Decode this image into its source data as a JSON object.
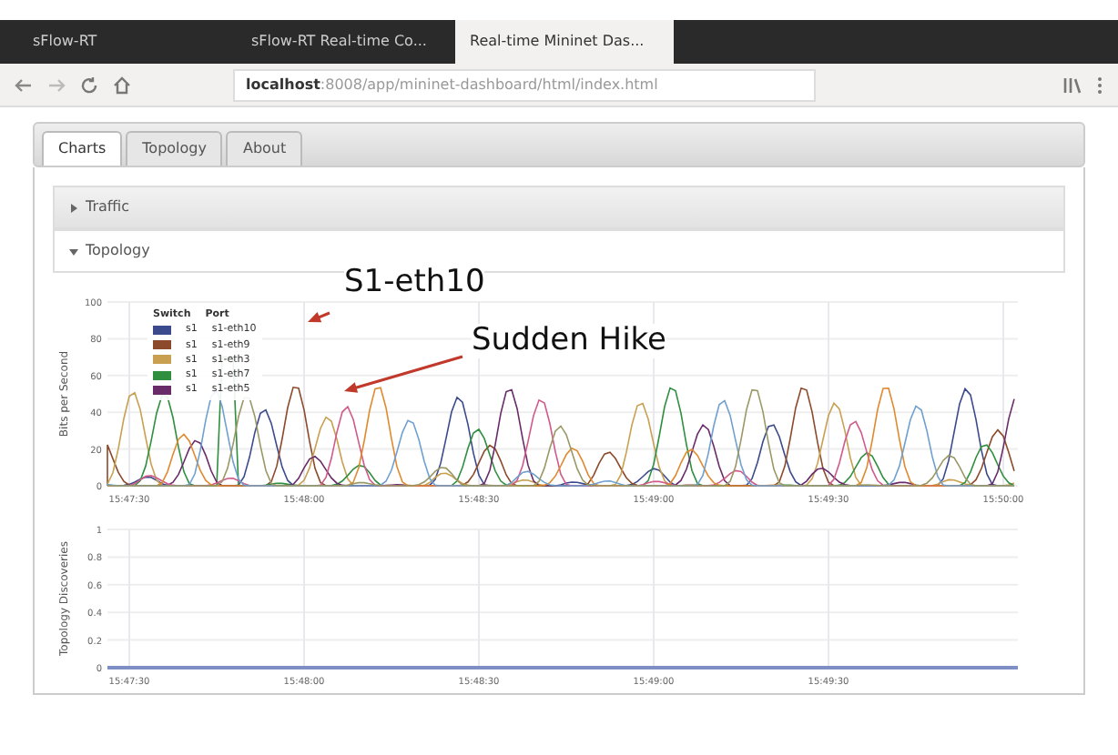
{
  "browser_tabs": [
    {
      "title": "sFlow-RT",
      "selected": false
    },
    {
      "title": "sFlow-RT Real-time Co...",
      "selected": false
    },
    {
      "title": "Real-time Mininet Das...",
      "selected": true
    }
  ],
  "address_bar": {
    "host": "localhost",
    "path": ":8008/app/mininet-dashboard/html/index.html"
  },
  "page_tabs": [
    {
      "label": "Charts",
      "selected": true
    },
    {
      "label": "Topology",
      "selected": false
    },
    {
      "label": "About",
      "selected": false
    }
  ],
  "sections": [
    {
      "label": "Traffic",
      "expanded": false
    },
    {
      "label": "Topology",
      "expanded": true
    }
  ],
  "traffic_chart": {
    "ylabel": "Bits per Second",
    "yticks": [
      "100",
      "80",
      "60",
      "40",
      "20",
      "0"
    ],
    "xticks": [
      "15:47:30",
      "15:48:00",
      "15:48:30",
      "15:49:00",
      "15:49:30",
      "15:50:00"
    ],
    "legend_headers": [
      "Switch",
      "Port"
    ],
    "legend": [
      {
        "switch": "s1",
        "port": "s1-eth10",
        "color": "#3b4a8c"
      },
      {
        "switch": "s1",
        "port": "s1-eth9",
        "color": "#8c4a2b"
      },
      {
        "switch": "s1",
        "port": "s1-eth3",
        "color": "#c8a050"
      },
      {
        "switch": "s1",
        "port": "s1-eth7",
        "color": "#2f8f3f"
      },
      {
        "switch": "s1",
        "port": "s1-eth5",
        "color": "#6a2b6a"
      }
    ]
  },
  "discovery_chart": {
    "ylabel": "Topology Discoveries",
    "yticks": [
      "1",
      "0.8",
      "0.6",
      "0.4",
      "0.2",
      "0"
    ],
    "xticks": [
      "15:47:30",
      "15:48:00",
      "15:48:30",
      "15:49:00",
      "15:49:30"
    ]
  },
  "annotations": [
    {
      "text": "S1-eth10"
    },
    {
      "text": "Sudden Hike"
    }
  ]
}
